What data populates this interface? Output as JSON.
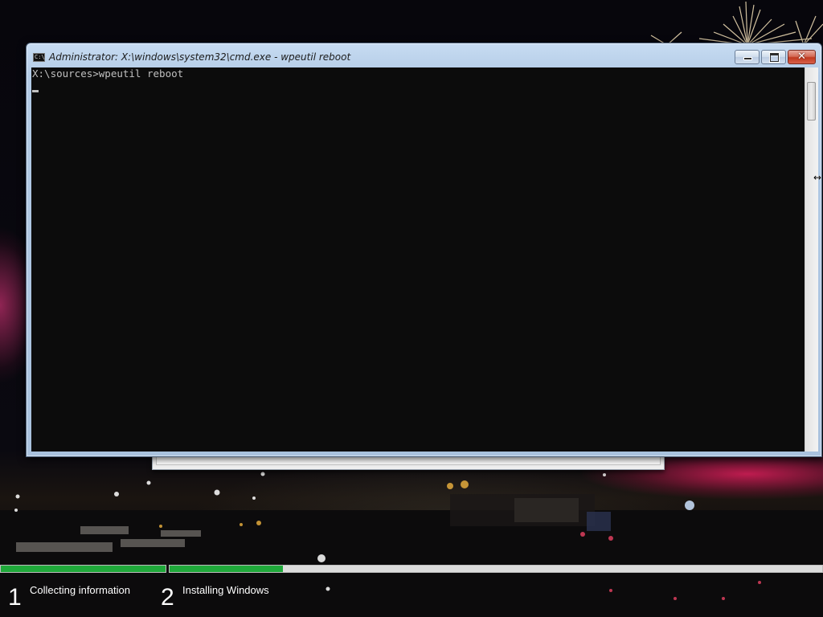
{
  "window": {
    "title": "Administrator: X:\\windows\\system32\\cmd.exe - wpeutil  reboot",
    "icon": "cmd-icon",
    "icon_text": "C:\\"
  },
  "console": {
    "lines": [
      "X:\\sources>wpeutil reboot"
    ]
  },
  "setup": {
    "steps": [
      {
        "number": "1",
        "label": "Collecting information",
        "progress": 1.0
      },
      {
        "number": "2",
        "label": "Installing Windows",
        "progress": 0.174
      }
    ],
    "accent": "#1fa83a"
  }
}
